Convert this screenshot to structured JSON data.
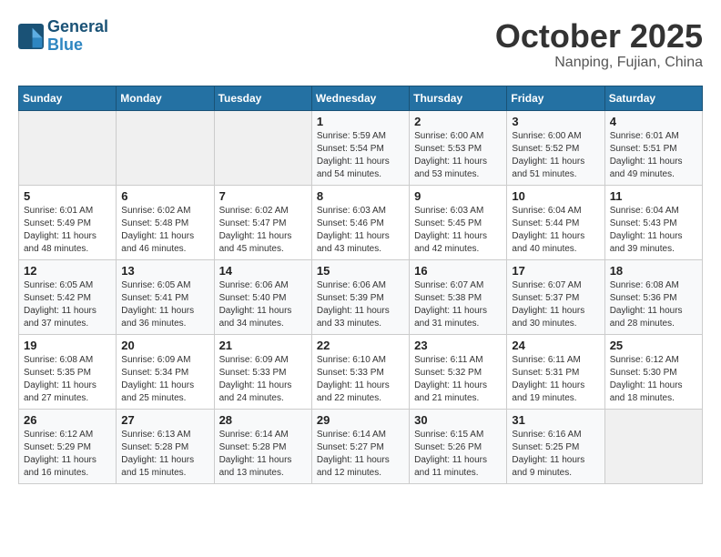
{
  "header": {
    "logo_line1": "General",
    "logo_line2": "Blue",
    "month": "October 2025",
    "location": "Nanping, Fujian, China"
  },
  "weekdays": [
    "Sunday",
    "Monday",
    "Tuesday",
    "Wednesday",
    "Thursday",
    "Friday",
    "Saturday"
  ],
  "weeks": [
    [
      {
        "day": "",
        "detail": ""
      },
      {
        "day": "",
        "detail": ""
      },
      {
        "day": "",
        "detail": ""
      },
      {
        "day": "1",
        "detail": "Sunrise: 5:59 AM\nSunset: 5:54 PM\nDaylight: 11 hours\nand 54 minutes."
      },
      {
        "day": "2",
        "detail": "Sunrise: 6:00 AM\nSunset: 5:53 PM\nDaylight: 11 hours\nand 53 minutes."
      },
      {
        "day": "3",
        "detail": "Sunrise: 6:00 AM\nSunset: 5:52 PM\nDaylight: 11 hours\nand 51 minutes."
      },
      {
        "day": "4",
        "detail": "Sunrise: 6:01 AM\nSunset: 5:51 PM\nDaylight: 11 hours\nand 49 minutes."
      }
    ],
    [
      {
        "day": "5",
        "detail": "Sunrise: 6:01 AM\nSunset: 5:49 PM\nDaylight: 11 hours\nand 48 minutes."
      },
      {
        "day": "6",
        "detail": "Sunrise: 6:02 AM\nSunset: 5:48 PM\nDaylight: 11 hours\nand 46 minutes."
      },
      {
        "day": "7",
        "detail": "Sunrise: 6:02 AM\nSunset: 5:47 PM\nDaylight: 11 hours\nand 45 minutes."
      },
      {
        "day": "8",
        "detail": "Sunrise: 6:03 AM\nSunset: 5:46 PM\nDaylight: 11 hours\nand 43 minutes."
      },
      {
        "day": "9",
        "detail": "Sunrise: 6:03 AM\nSunset: 5:45 PM\nDaylight: 11 hours\nand 42 minutes."
      },
      {
        "day": "10",
        "detail": "Sunrise: 6:04 AM\nSunset: 5:44 PM\nDaylight: 11 hours\nand 40 minutes."
      },
      {
        "day": "11",
        "detail": "Sunrise: 6:04 AM\nSunset: 5:43 PM\nDaylight: 11 hours\nand 39 minutes."
      }
    ],
    [
      {
        "day": "12",
        "detail": "Sunrise: 6:05 AM\nSunset: 5:42 PM\nDaylight: 11 hours\nand 37 minutes."
      },
      {
        "day": "13",
        "detail": "Sunrise: 6:05 AM\nSunset: 5:41 PM\nDaylight: 11 hours\nand 36 minutes."
      },
      {
        "day": "14",
        "detail": "Sunrise: 6:06 AM\nSunset: 5:40 PM\nDaylight: 11 hours\nand 34 minutes."
      },
      {
        "day": "15",
        "detail": "Sunrise: 6:06 AM\nSunset: 5:39 PM\nDaylight: 11 hours\nand 33 minutes."
      },
      {
        "day": "16",
        "detail": "Sunrise: 6:07 AM\nSunset: 5:38 PM\nDaylight: 11 hours\nand 31 minutes."
      },
      {
        "day": "17",
        "detail": "Sunrise: 6:07 AM\nSunset: 5:37 PM\nDaylight: 11 hours\nand 30 minutes."
      },
      {
        "day": "18",
        "detail": "Sunrise: 6:08 AM\nSunset: 5:36 PM\nDaylight: 11 hours\nand 28 minutes."
      }
    ],
    [
      {
        "day": "19",
        "detail": "Sunrise: 6:08 AM\nSunset: 5:35 PM\nDaylight: 11 hours\nand 27 minutes."
      },
      {
        "day": "20",
        "detail": "Sunrise: 6:09 AM\nSunset: 5:34 PM\nDaylight: 11 hours\nand 25 minutes."
      },
      {
        "day": "21",
        "detail": "Sunrise: 6:09 AM\nSunset: 5:33 PM\nDaylight: 11 hours\nand 24 minutes."
      },
      {
        "day": "22",
        "detail": "Sunrise: 6:10 AM\nSunset: 5:33 PM\nDaylight: 11 hours\nand 22 minutes."
      },
      {
        "day": "23",
        "detail": "Sunrise: 6:11 AM\nSunset: 5:32 PM\nDaylight: 11 hours\nand 21 minutes."
      },
      {
        "day": "24",
        "detail": "Sunrise: 6:11 AM\nSunset: 5:31 PM\nDaylight: 11 hours\nand 19 minutes."
      },
      {
        "day": "25",
        "detail": "Sunrise: 6:12 AM\nSunset: 5:30 PM\nDaylight: 11 hours\nand 18 minutes."
      }
    ],
    [
      {
        "day": "26",
        "detail": "Sunrise: 6:12 AM\nSunset: 5:29 PM\nDaylight: 11 hours\nand 16 minutes."
      },
      {
        "day": "27",
        "detail": "Sunrise: 6:13 AM\nSunset: 5:28 PM\nDaylight: 11 hours\nand 15 minutes."
      },
      {
        "day": "28",
        "detail": "Sunrise: 6:14 AM\nSunset: 5:28 PM\nDaylight: 11 hours\nand 13 minutes."
      },
      {
        "day": "29",
        "detail": "Sunrise: 6:14 AM\nSunset: 5:27 PM\nDaylight: 11 hours\nand 12 minutes."
      },
      {
        "day": "30",
        "detail": "Sunrise: 6:15 AM\nSunset: 5:26 PM\nDaylight: 11 hours\nand 11 minutes."
      },
      {
        "day": "31",
        "detail": "Sunrise: 6:16 AM\nSunset: 5:25 PM\nDaylight: 11 hours\nand 9 minutes."
      },
      {
        "day": "",
        "detail": ""
      }
    ]
  ]
}
